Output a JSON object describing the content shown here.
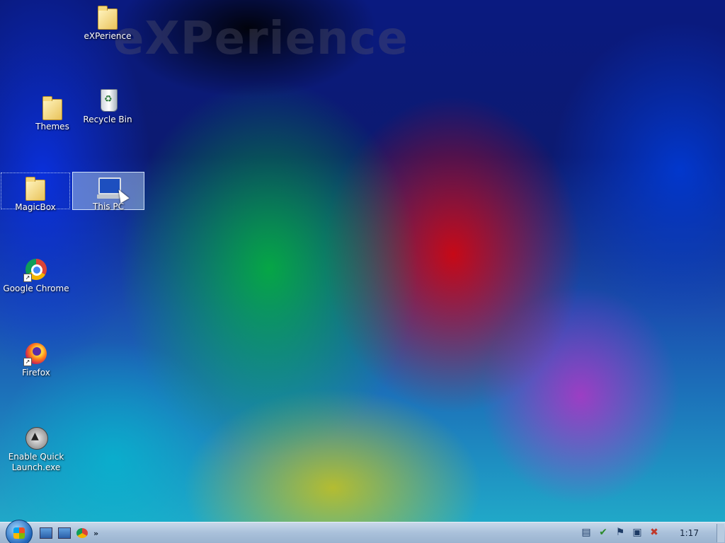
{
  "wallpaper": {
    "watermark": "eXPerience"
  },
  "desktop_icons": [
    {
      "label": "eXPerience",
      "icon": "folder-icon"
    },
    {
      "label": "Themes",
      "icon": "folder-icon"
    },
    {
      "label": "Recycle Bin",
      "icon": "recycle-bin-icon"
    },
    {
      "label": "MagicBox",
      "icon": "folder-icon"
    },
    {
      "label": "This PC",
      "icon": "computer-icon",
      "selected": true
    },
    {
      "label": "Google Chrome",
      "icon": "chrome-icon"
    },
    {
      "label": "Firefox",
      "icon": "firefox-icon"
    },
    {
      "label": "Enable Quick Launch.exe",
      "icon": "app-icon"
    }
  ],
  "taskbar": {
    "start_icon": "start-orb-icon",
    "quick_launch": [
      "show-desktop-icon",
      "switch-windows-icon",
      "chrome-icon"
    ],
    "more": "»",
    "tray_icons": [
      "notes-icon",
      "security-icon",
      "flag-icon",
      "network-icon",
      "volume-muted-icon"
    ],
    "clock": "1:17"
  }
}
